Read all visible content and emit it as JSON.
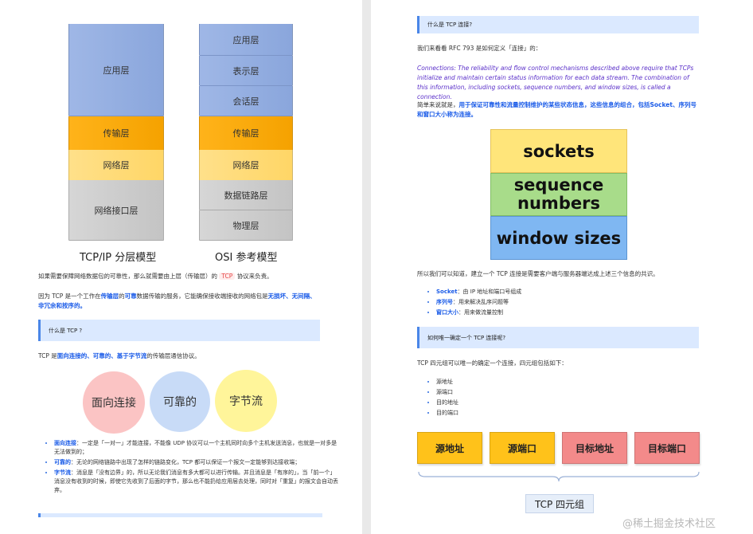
{
  "left": {
    "tcpip_layers": [
      "应用层",
      "传输层",
      "网络层",
      "网络接口层"
    ],
    "tcpip_caption": "TCP/IP 分层模型",
    "osi_layers": [
      "应用层",
      "表示层",
      "会话层",
      "传输层",
      "网络层",
      "数据链路层",
      "物理层"
    ],
    "osi_caption": "OSI 参考模型",
    "para1_a": "如果需要保障网络数据包的可靠性，那么就需要由上层（传输层）的",
    "para1_badge": "TCP",
    "para1_b": "协议来负责。",
    "para2_a": "因为 TCP 是一个工作在",
    "para2_h1": "传输层",
    "para2_b": "的",
    "para2_h2": "可靠",
    "para2_c": "数据传输的服务，它能确保接收端接收的网络包是",
    "para2_h3": "无损坏、无间隔、非冗余和按序的。",
    "q1": "什么是 TCP ?",
    "tcp_def_a": "TCP 是",
    "tcp_def_h": "面向连接的、可靠的、基于字节流",
    "tcp_def_b": "的传输层通信协议。",
    "circles": [
      "面向连接",
      "可靠的",
      "字节流"
    ],
    "bullets": [
      {
        "term": "面向连接",
        "text": "：一定是「一对一」才能连接，不能像 UDP 协议可以一个主机同时向多个主机发送消息，也就是一对多是无法做到的；"
      },
      {
        "term": "可靠的",
        "text": "：无论的网络链路中出现了怎样的链路变化，TCP 都可以保证一个报文一定能够到达接收端；"
      },
      {
        "term": "字节流",
        "text": "：消息是「没有边界」的，所以无论我们消息有多大都可以进行传输。并且消息是「有序的」，当「前一个」消息没有收到的时候，即使它先收到了后面的字节，那么也不能扔给应用层去处理，同时对「重复」的报文会自动丢弃。"
      }
    ]
  },
  "right": {
    "q2": "什么是 TCP 连接?",
    "rfc_intro": "我们来看看 RFC 793 是如何定义「连接」的：",
    "rfc_quote": "Connections: The reliability and flow control mechanisms described above require that TCPs initialize and maintain certain status information for each data stream. The combination of this information, including sockets, sequence numbers, and window sizes, is called a connection.",
    "summary_a": "简单来说就是，",
    "summary_h": "用于保证可靠性和流量控制维护的某些状态信息，这些信息的组合，包括Socket、序列号和窗口大小称为连接。",
    "boxes": [
      "sockets",
      "sequence numbers",
      "window sizes"
    ],
    "need_text": "所以我们可以知道，建立一个 TCP 连接是需要客户端与服务器端达成上述三个信息的共识。",
    "items": [
      {
        "term": "Socket",
        "text": "：由 IP 地址和端口号组成"
      },
      {
        "term": "序列号",
        "text": "：用来解决乱序问题等"
      },
      {
        "term": "窗口大小",
        "text": "：用来做流量控制"
      }
    ],
    "q3": "如何唯一确定一个 TCP 连接呢?",
    "tuple_intro": "TCP 四元组可以唯一的确定一个连接，四元组包括如下：",
    "tuple_list": [
      "源地址",
      "源端口",
      "目的地址",
      "目的端口"
    ],
    "tuple_boxes": [
      "源地址",
      "源端口",
      "目标地址",
      "目标端口"
    ],
    "tuple_label": "TCP 四元组",
    "watermark": "@稀土掘金技术社区"
  },
  "colors": {
    "blue_layer": "#9fb7e6",
    "orange_layer": "#ffb31a",
    "yellow_layer": "#ffe08a",
    "gray_layer": "#d0d0d0",
    "accent": "#1a5be8",
    "qbar": "#dbe9ff"
  }
}
